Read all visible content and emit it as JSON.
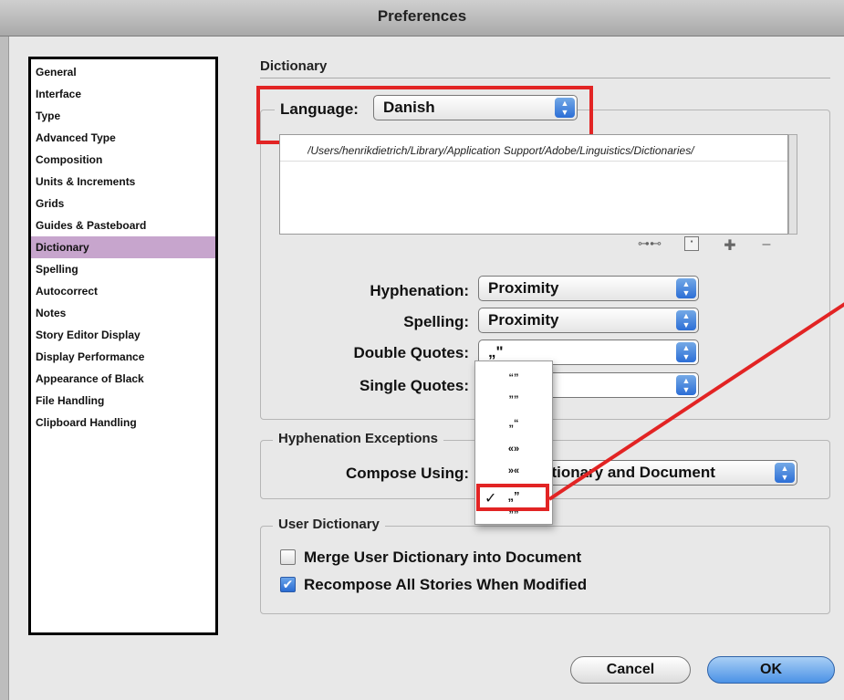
{
  "window": {
    "title": "Preferences"
  },
  "sidebar": {
    "items": [
      {
        "label": "General"
      },
      {
        "label": "Interface"
      },
      {
        "label": "Type"
      },
      {
        "label": "Advanced Type"
      },
      {
        "label": "Composition"
      },
      {
        "label": "Units & Increments"
      },
      {
        "label": "Grids"
      },
      {
        "label": "Guides & Pasteboard"
      },
      {
        "label": "Dictionary"
      },
      {
        "label": "Spelling"
      },
      {
        "label": "Autocorrect"
      },
      {
        "label": "Notes"
      },
      {
        "label": "Story Editor Display"
      },
      {
        "label": "Display Performance"
      },
      {
        "label": "Appearance of Black"
      },
      {
        "label": "File Handling"
      },
      {
        "label": "Clipboard Handling"
      }
    ],
    "selected": "Dictionary"
  },
  "dictionary": {
    "section_title": "Dictionary",
    "language_label": "Language:",
    "language_value": "Danish",
    "dictionary_path": "/Users/henrikdietrich/Library/Application Support/Adobe/Linguistics/Dictionaries/",
    "tools": [
      "link-icon",
      "new-icon",
      "add-icon",
      "remove-icon"
    ],
    "hyphenation_label": "Hyphenation:",
    "hyphenation_value": "Proximity",
    "spelling_label": "Spelling:",
    "spelling_value": "Proximity",
    "double_quotes_label": "Double Quotes:",
    "double_quotes_value": "„\"",
    "single_quotes_label": "Single Quotes:",
    "single_quotes_value": ""
  },
  "quotes_menu": {
    "options": [
      "“”",
      "””",
      "„“",
      "«»",
      "»«",
      "„”",
      "””"
    ],
    "checkmark": "✓"
  },
  "hyphenation_exceptions": {
    "legend": "Hyphenation Exceptions",
    "compose_label": "Compose Using:",
    "compose_value": "ctionary and Document"
  },
  "user_dictionary": {
    "legend": "User Dictionary",
    "merge_label": "Merge User Dictionary into Document",
    "merge_checked": false,
    "recompose_label": "Recompose All Stories When Modified",
    "recompose_checked": true,
    "check_glyph": "✔"
  },
  "buttons": {
    "cancel": "Cancel",
    "ok": "OK"
  },
  "colors": {
    "selection": "#c7a5cd",
    "highlight_red": "#e22424",
    "aqua_blue": "#2c6ed6"
  }
}
